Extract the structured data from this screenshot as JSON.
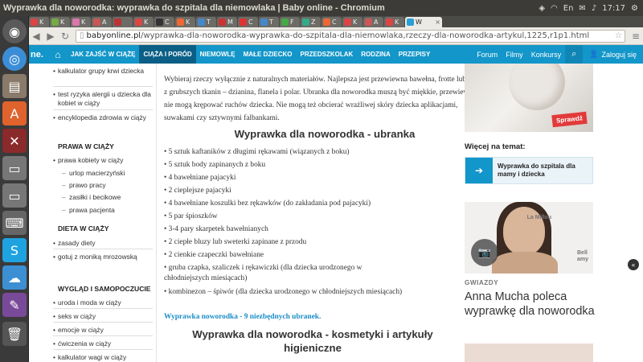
{
  "window": {
    "title": "Wyprawka dla noworodka: wyprawka do szpitala dla niemowlaka | Baby online - Chromium"
  },
  "tray": {
    "lang": "En",
    "time": "17:17"
  },
  "tabs": [
    {
      "label": "K",
      "color": "#d44"
    },
    {
      "label": "K",
      "color": "#7a4"
    },
    {
      "label": "K",
      "color": "#d7a"
    },
    {
      "label": "A",
      "color": "#c55"
    },
    {
      "label": "",
      "color": "#b33"
    },
    {
      "label": "K",
      "color": "#d44"
    },
    {
      "label": "C",
      "color": "#333"
    },
    {
      "label": "K",
      "color": "#e63"
    },
    {
      "label": "T",
      "color": "#48c"
    },
    {
      "label": "M",
      "color": "#c33"
    },
    {
      "label": "C",
      "color": "#d33"
    },
    {
      "label": "T",
      "color": "#48c"
    },
    {
      "label": "F",
      "color": "#4a4"
    },
    {
      "label": "Z",
      "color": "#3a8"
    },
    {
      "label": "C",
      "color": "#e63"
    },
    {
      "label": "K",
      "color": "#d44"
    },
    {
      "label": "A",
      "color": "#c55"
    },
    {
      "label": "K",
      "color": "#d44"
    },
    {
      "label": "W",
      "color": "#2a9fd6",
      "active": true
    }
  ],
  "address": {
    "domain": "babyonline.pl",
    "path": "/wyprawka-dla-noworodka-wyprawka-do-szpitala-dla-niemowlaka,rzeczy-dla-noworodka-artykul,1225,r1p1.html"
  },
  "sitenav": {
    "logo": "ne.",
    "items": [
      "JAK ZAJŚĆ W CIĄŻĘ",
      "CIĄŻA I PORÓD",
      "NIEMOWLĘ",
      "MAŁE DZIECKO",
      "PRZEDSZKOLAK",
      "RODZINA",
      "PRZEPISY"
    ],
    "right": [
      "Forum",
      "Filmy",
      "Konkursy"
    ],
    "login": "Zaloguj się"
  },
  "left": {
    "top_items": [
      "kalkulator grupy krwi dziecka",
      "test ryzyka alergii u dziecka dla kobiet w ciąży",
      "encyklopedia zdrowia w ciąży"
    ],
    "sections": [
      {
        "title": "PRAWA W CIĄŻY",
        "items": [
          "prawa kobiety w ciąży"
        ],
        "subs": [
          "urlop macierzyński",
          "prawo pracy",
          "zasiłki i becikowe",
          "prawa pacjenta"
        ]
      },
      {
        "title": "DIETA W CIĄŻY",
        "items": [
          "zasady diety",
          "gotuj z moniką mrozowską"
        ]
      },
      {
        "title": "WYGLĄD I SAMOPOCZUCIE",
        "items": [
          "uroda i moda w ciąży",
          "seks w ciąży",
          "emocje w ciąży",
          "ćwiczenia w ciąży",
          "kalkulator wagi w ciąży"
        ]
      }
    ]
  },
  "article": {
    "intro": "Wybieraj rzeczy wyłącznie z naturalnych materiałów. Najlepsza jest przewiewna bawełna, frotte lub tetra, z grubszych tkanin – dzianina, flanela i polar. Ubranka dla noworodka muszą być miękkie, przewiewne i nie mogą krępować ruchów dziecka. Nie mogą też obcierać wrażliwej skóry dziecka aplikacjami, suwakami czy sztywnymi falbankami.",
    "h_ubranka": "Wyprawka dla noworodka - ubranka",
    "list": [
      "• 5 sztuk kaftaników z długimi rękawami (wiązanych z boku)",
      "• 5 sztuk body zapinanych z boku",
      "• 4 bawełniane pajacyki",
      "• 2 cieplejsze pajacyki",
      "• 4 bawełniane koszulki bez rękawków (do zakładania pod pajacyki)",
      "• 5 par śpioszków",
      "• 3-4 pary skarpetek bawełnianych",
      "• 2 ciepłe bluzy lub sweterki zapinane z przodu",
      "• 2 cienkie czapeczki bawełniane",
      "• gruba czapka, szaliczek i rękawiczki (dla dziecka urodzonego w chłodniejszych miesiącach)",
      "• kombinezon – śpiwór (dla dziecka urodzonego w chłodniejszych miesiącach)"
    ],
    "link": "Wyprawka noworodka - 9 niezbędnych ubranek.",
    "h_kosmetyki": "Wyprawka dla noworodka - kosmetyki i artykuły higieniczne"
  },
  "right": {
    "badge": "Sprawdź",
    "more_title": "Więcej na temat:",
    "related": "Wyprawka do szpitala dla mamy i dziecka",
    "img2_logo_a": "La Millou",
    "img2_logo_b": "Bell amy",
    "category": "GWIAZDY",
    "headline": "Anna Mucha poleca wyprawkę dla noworodka"
  }
}
